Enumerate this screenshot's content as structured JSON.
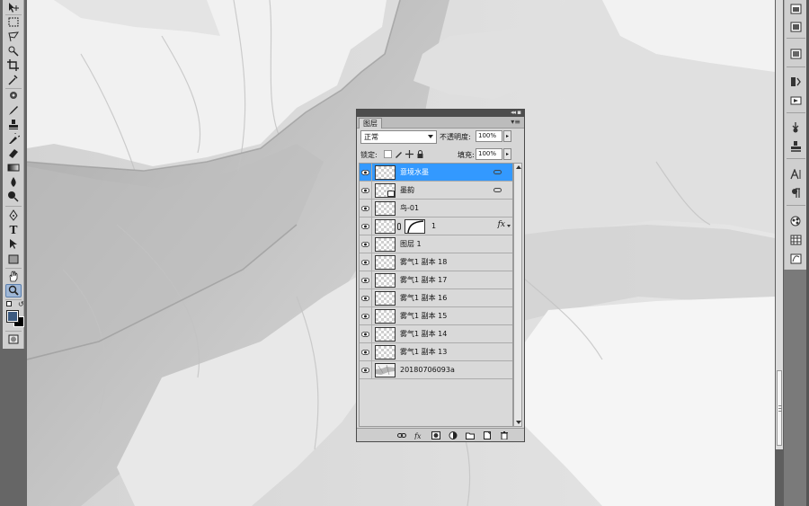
{
  "toolbox": {
    "tools": [
      {
        "name": "move-tool",
        "icon": "move-icon"
      },
      {
        "name": "marquee-tool",
        "icon": "marquee-icon"
      },
      {
        "name": "lasso-tool",
        "icon": "lasso-icon"
      },
      {
        "name": "quick-selection-tool",
        "icon": "magic-wand-icon"
      },
      {
        "name": "crop-tool",
        "icon": "crop-icon"
      },
      {
        "name": "eyedropper-tool",
        "icon": "eyedropper-icon"
      },
      {
        "name": "spot-healing-tool",
        "icon": "healing-icon"
      },
      {
        "name": "brush-tool",
        "icon": "brush-icon"
      },
      {
        "name": "clone-stamp-tool",
        "icon": "stamp-icon"
      },
      {
        "name": "history-brush-tool",
        "icon": "history-brush-icon"
      },
      {
        "name": "eraser-tool",
        "icon": "eraser-icon"
      },
      {
        "name": "gradient-tool",
        "icon": "gradient-icon"
      },
      {
        "name": "blur-tool",
        "icon": "blur-icon"
      },
      {
        "name": "dodge-tool",
        "icon": "dodge-icon"
      },
      {
        "name": "pen-tool",
        "icon": "pen-icon"
      },
      {
        "name": "type-tool",
        "icon": "type-icon",
        "glyph": "T"
      },
      {
        "name": "path-selection-tool",
        "icon": "path-select-icon"
      },
      {
        "name": "shape-tool",
        "icon": "rectangle-icon"
      },
      {
        "name": "hand-tool",
        "icon": "hand-icon"
      },
      {
        "name": "zoom-tool",
        "icon": "zoom-icon"
      }
    ],
    "foreground_color": "#3c5a80",
    "background_color": "#000000"
  },
  "layers_panel": {
    "tab_label": "图层",
    "blend_mode": "正常",
    "opacity_label": "不透明度:",
    "opacity_value": "100%",
    "lock_label": "锁定:",
    "fill_label": "填充:",
    "fill_value": "100%",
    "selected_color": "#3399ff",
    "layers": [
      {
        "name": "意境水墨",
        "selected": true,
        "thumb": "checker",
        "clip": true
      },
      {
        "name": "墨韵",
        "selected": false,
        "thumb": "smart",
        "clip": true
      },
      {
        "name": "鸟-01",
        "selected": false,
        "thumb": "checker"
      },
      {
        "name": "1",
        "selected": false,
        "thumb": "checker",
        "mask": true,
        "fx": "fx"
      },
      {
        "name": "图层 1",
        "selected": false,
        "thumb": "checker"
      },
      {
        "name": "雾气1 副本 18",
        "selected": false,
        "thumb": "checker"
      },
      {
        "name": "雾气1 副本 17",
        "selected": false,
        "thumb": "checker"
      },
      {
        "name": "雾气1 副本 16",
        "selected": false,
        "thumb": "checker"
      },
      {
        "name": "雾气1 副本 15",
        "selected": false,
        "thumb": "checker"
      },
      {
        "name": "雾气1 副本 14",
        "selected": false,
        "thumb": "checker"
      },
      {
        "name": "雾气1 副本 13",
        "selected": false,
        "thumb": "checker"
      },
      {
        "name": "20180706093a",
        "selected": false,
        "thumb": "photo"
      }
    ],
    "bottom_buttons": [
      "link-layers-icon",
      "fx-icon",
      "add-mask-icon",
      "adjustment-layer-icon",
      "new-group-icon",
      "new-layer-icon",
      "trash-icon"
    ]
  },
  "dock": {
    "buttons": [
      "history-icon",
      "actions-icon",
      "navigator-icon",
      "channels-icon",
      "paths-icon",
      "brushes-icon",
      "clone-source-icon",
      "character-icon",
      "paragraph-icon",
      "styles-icon",
      "swatches-icon",
      "adjustments-icon"
    ]
  }
}
